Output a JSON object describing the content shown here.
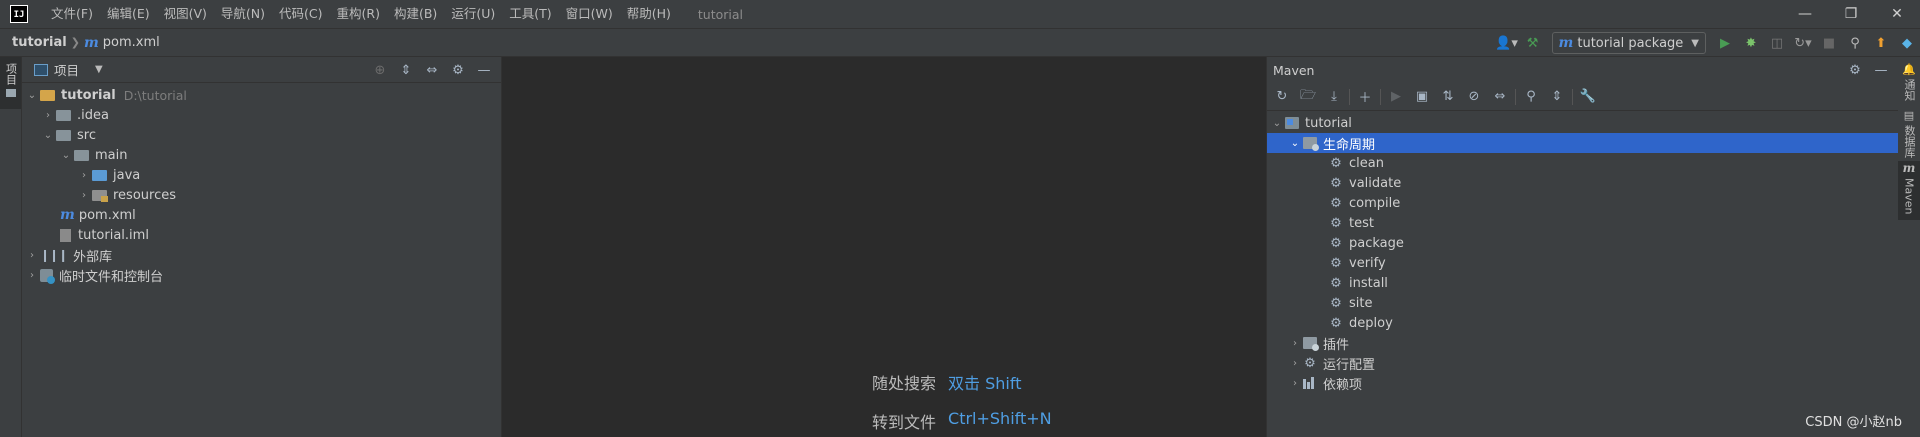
{
  "menubar": {
    "logo": "IJ",
    "items": [
      "文件(F)",
      "编辑(E)",
      "视图(V)",
      "导航(N)",
      "代码(C)",
      "重构(R)",
      "构建(B)",
      "运行(U)",
      "工具(T)",
      "窗口(W)",
      "帮助(H)"
    ],
    "project_title": "tutorial",
    "window_controls": [
      "minimize-icon",
      "restore-icon",
      "close-icon"
    ]
  },
  "navbar": {
    "project": "tutorial",
    "file": "pom.xml",
    "run_config": "tutorial package"
  },
  "left_stripe": {
    "tab_label": "项目"
  },
  "project_panel": {
    "title": "项目",
    "tree": {
      "root": {
        "label": "tutorial",
        "path": "D:\\tutorial"
      },
      "idea": ".idea",
      "src": "src",
      "main": "main",
      "java": "java",
      "resources": "resources",
      "pom": "pom.xml",
      "iml": "tutorial.iml",
      "ext_libs": "外部库",
      "scratches": "临时文件和控制台"
    }
  },
  "editor": {
    "hints": [
      {
        "label": "随处搜索",
        "shortcut": "双击 Shift"
      },
      {
        "label": "转到文件",
        "shortcut": "Ctrl+Shift+N"
      }
    ]
  },
  "maven": {
    "title": "Maven",
    "project": "tutorial",
    "lifecycle_label": "生命周期",
    "lifecycle": [
      "clean",
      "validate",
      "compile",
      "test",
      "package",
      "verify",
      "install",
      "site",
      "deploy"
    ],
    "plugins_label": "插件",
    "run_configs_label": "运行配置",
    "dependencies_label": "依赖项"
  },
  "right_stripe": {
    "notifications": "通知",
    "database": "数据库",
    "maven": "Maven"
  },
  "watermark": "CSDN @小赵nb",
  "colors": {
    "accent": "#4c8be0",
    "selection": "#2f65ca",
    "run_green": "#499c54"
  }
}
